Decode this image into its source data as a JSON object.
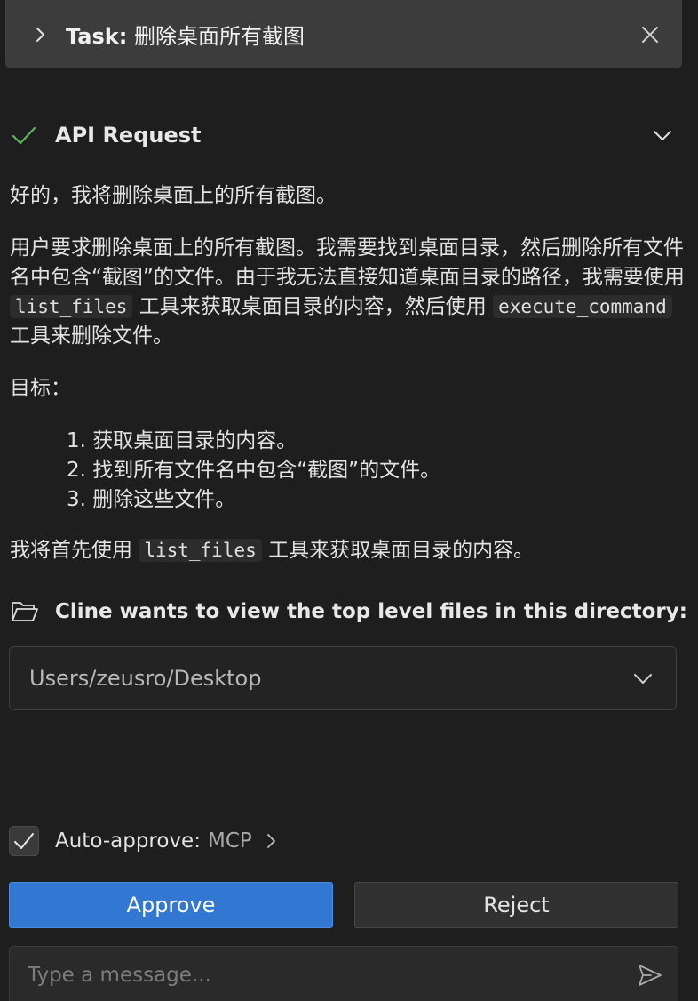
{
  "task": {
    "label": "Task:",
    "title": "删除桌面所有截图"
  },
  "api_request": {
    "title": "API Request"
  },
  "message": {
    "intro": "好的，我将删除桌面上的所有截图。",
    "para1_a": "用户要求删除桌面上的所有截图。我需要找到桌面目录，然后删除所有文件名中包含“截图”的文件。由于我无法直接知道桌面目录的路径，我需要使用",
    "para1_code1": "list_files",
    "para1_b": "工具来获取桌面目录的内容，然后使用",
    "para1_code2": "execute_command",
    "para1_c": "工具来删除文件。",
    "goal_label": "目标：",
    "goals": [
      "1. 获取桌面目录的内容。",
      "2. 找到所有文件名中包含“截图”的文件。",
      "3. 删除这些文件。"
    ],
    "final_a": "我将首先使用",
    "final_code": "list_files",
    "final_b": "工具来获取桌面目录的内容。"
  },
  "tool": {
    "title": "Cline wants to view the top level files in this directory:",
    "path": "Users/zeusro/Desktop"
  },
  "auto_approve": {
    "label": "Auto-approve:",
    "value": "MCP"
  },
  "buttons": {
    "approve": "Approve",
    "reject": "Reject"
  },
  "input": {
    "placeholder": "Type a message..."
  },
  "colors": {
    "background": "#1e1e1e",
    "header_bg": "#3c3c3c",
    "approve_bg": "#3277d1",
    "check_green": "#5db35d"
  }
}
